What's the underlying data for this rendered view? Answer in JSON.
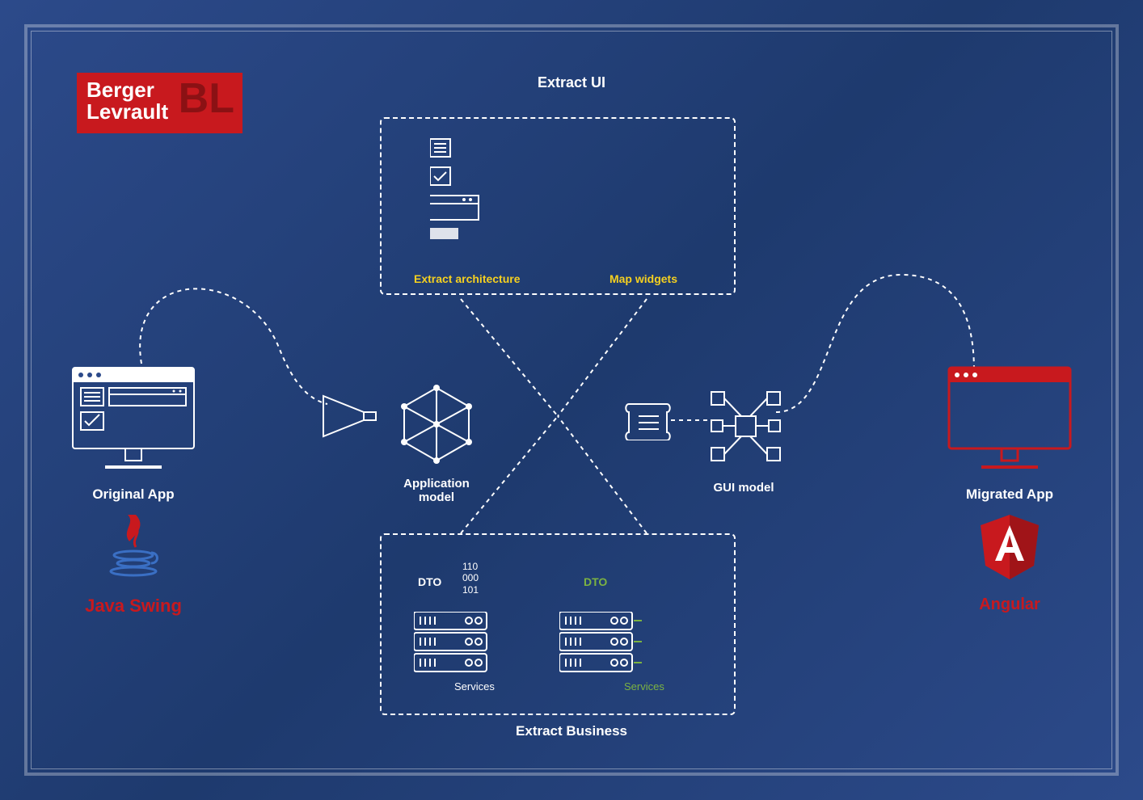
{
  "logo": {
    "line1": "Berger",
    "line2": "Levrault",
    "monogram": "BL"
  },
  "titles": {
    "top": "Extract UI",
    "bottom": "Extract Business"
  },
  "ui_box": {
    "extract_arch": "Extract architecture",
    "map_widgets": "Map widgets"
  },
  "business_box": {
    "dto_left": "DTO",
    "dto_right": "DTO",
    "services_left": "Services",
    "services_right": "Services",
    "binary": "110\n000\n101"
  },
  "models": {
    "app": "Application model",
    "gui": "GUI model"
  },
  "original": {
    "title": "Original App",
    "tech": "Java Swing"
  },
  "migrated": {
    "title": "Migrated App",
    "tech": "Angular"
  }
}
